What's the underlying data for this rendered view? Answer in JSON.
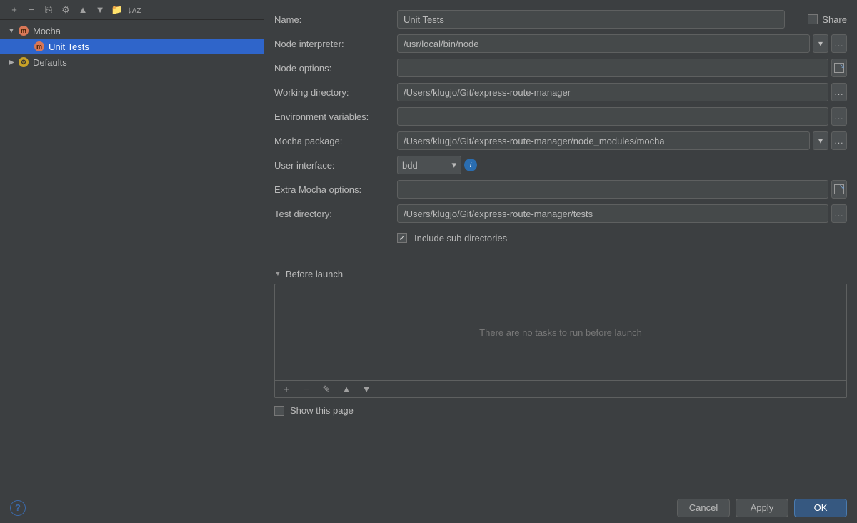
{
  "toolbar": {
    "add_icon": "+",
    "remove_icon": "−",
    "copy_icon": "⎘",
    "settings_icon": "⚙",
    "up_icon": "▲",
    "down_icon": "▼",
    "folder_icon": "📁",
    "sort_icon": "↓ᴀᴢ"
  },
  "tree": {
    "items": [
      {
        "label": "Mocha",
        "expanded": true,
        "icon": "mocha"
      },
      {
        "label": "Unit Tests",
        "child": true,
        "selected": true,
        "icon": "mocha"
      },
      {
        "label": "Defaults",
        "expanded": false,
        "icon": "gear"
      }
    ]
  },
  "form": {
    "name_label": "Name:",
    "name_value": "Unit Tests",
    "share_label": "Share",
    "interpreter_label": "Node interpreter:",
    "interpreter_value": "/usr/local/bin/node",
    "node_options_label": "Node options:",
    "node_options_value": "",
    "working_dir_label": "Working directory:",
    "working_dir_value": "/Users/klugjo/Git/express-route-manager",
    "env_label": "Environment variables:",
    "env_value": "",
    "mocha_pkg_label": "Mocha package:",
    "mocha_pkg_value": "/Users/klugjo/Git/express-route-manager/node_modules/mocha",
    "ui_label": "User interface:",
    "ui_value": "bdd",
    "extra_label": "Extra Mocha options:",
    "extra_value": "",
    "test_dir_label": "Test directory:",
    "test_dir_value": "/Users/klugjo/Git/express-route-manager/tests",
    "include_sub_label": "Include sub directories"
  },
  "before_launch": {
    "title": "Before launch",
    "empty_text": "There are no tasks to run before launch",
    "show_page_label": "Show this page"
  },
  "footer": {
    "cancel": "Cancel",
    "apply": "Apply",
    "ok": "OK"
  }
}
